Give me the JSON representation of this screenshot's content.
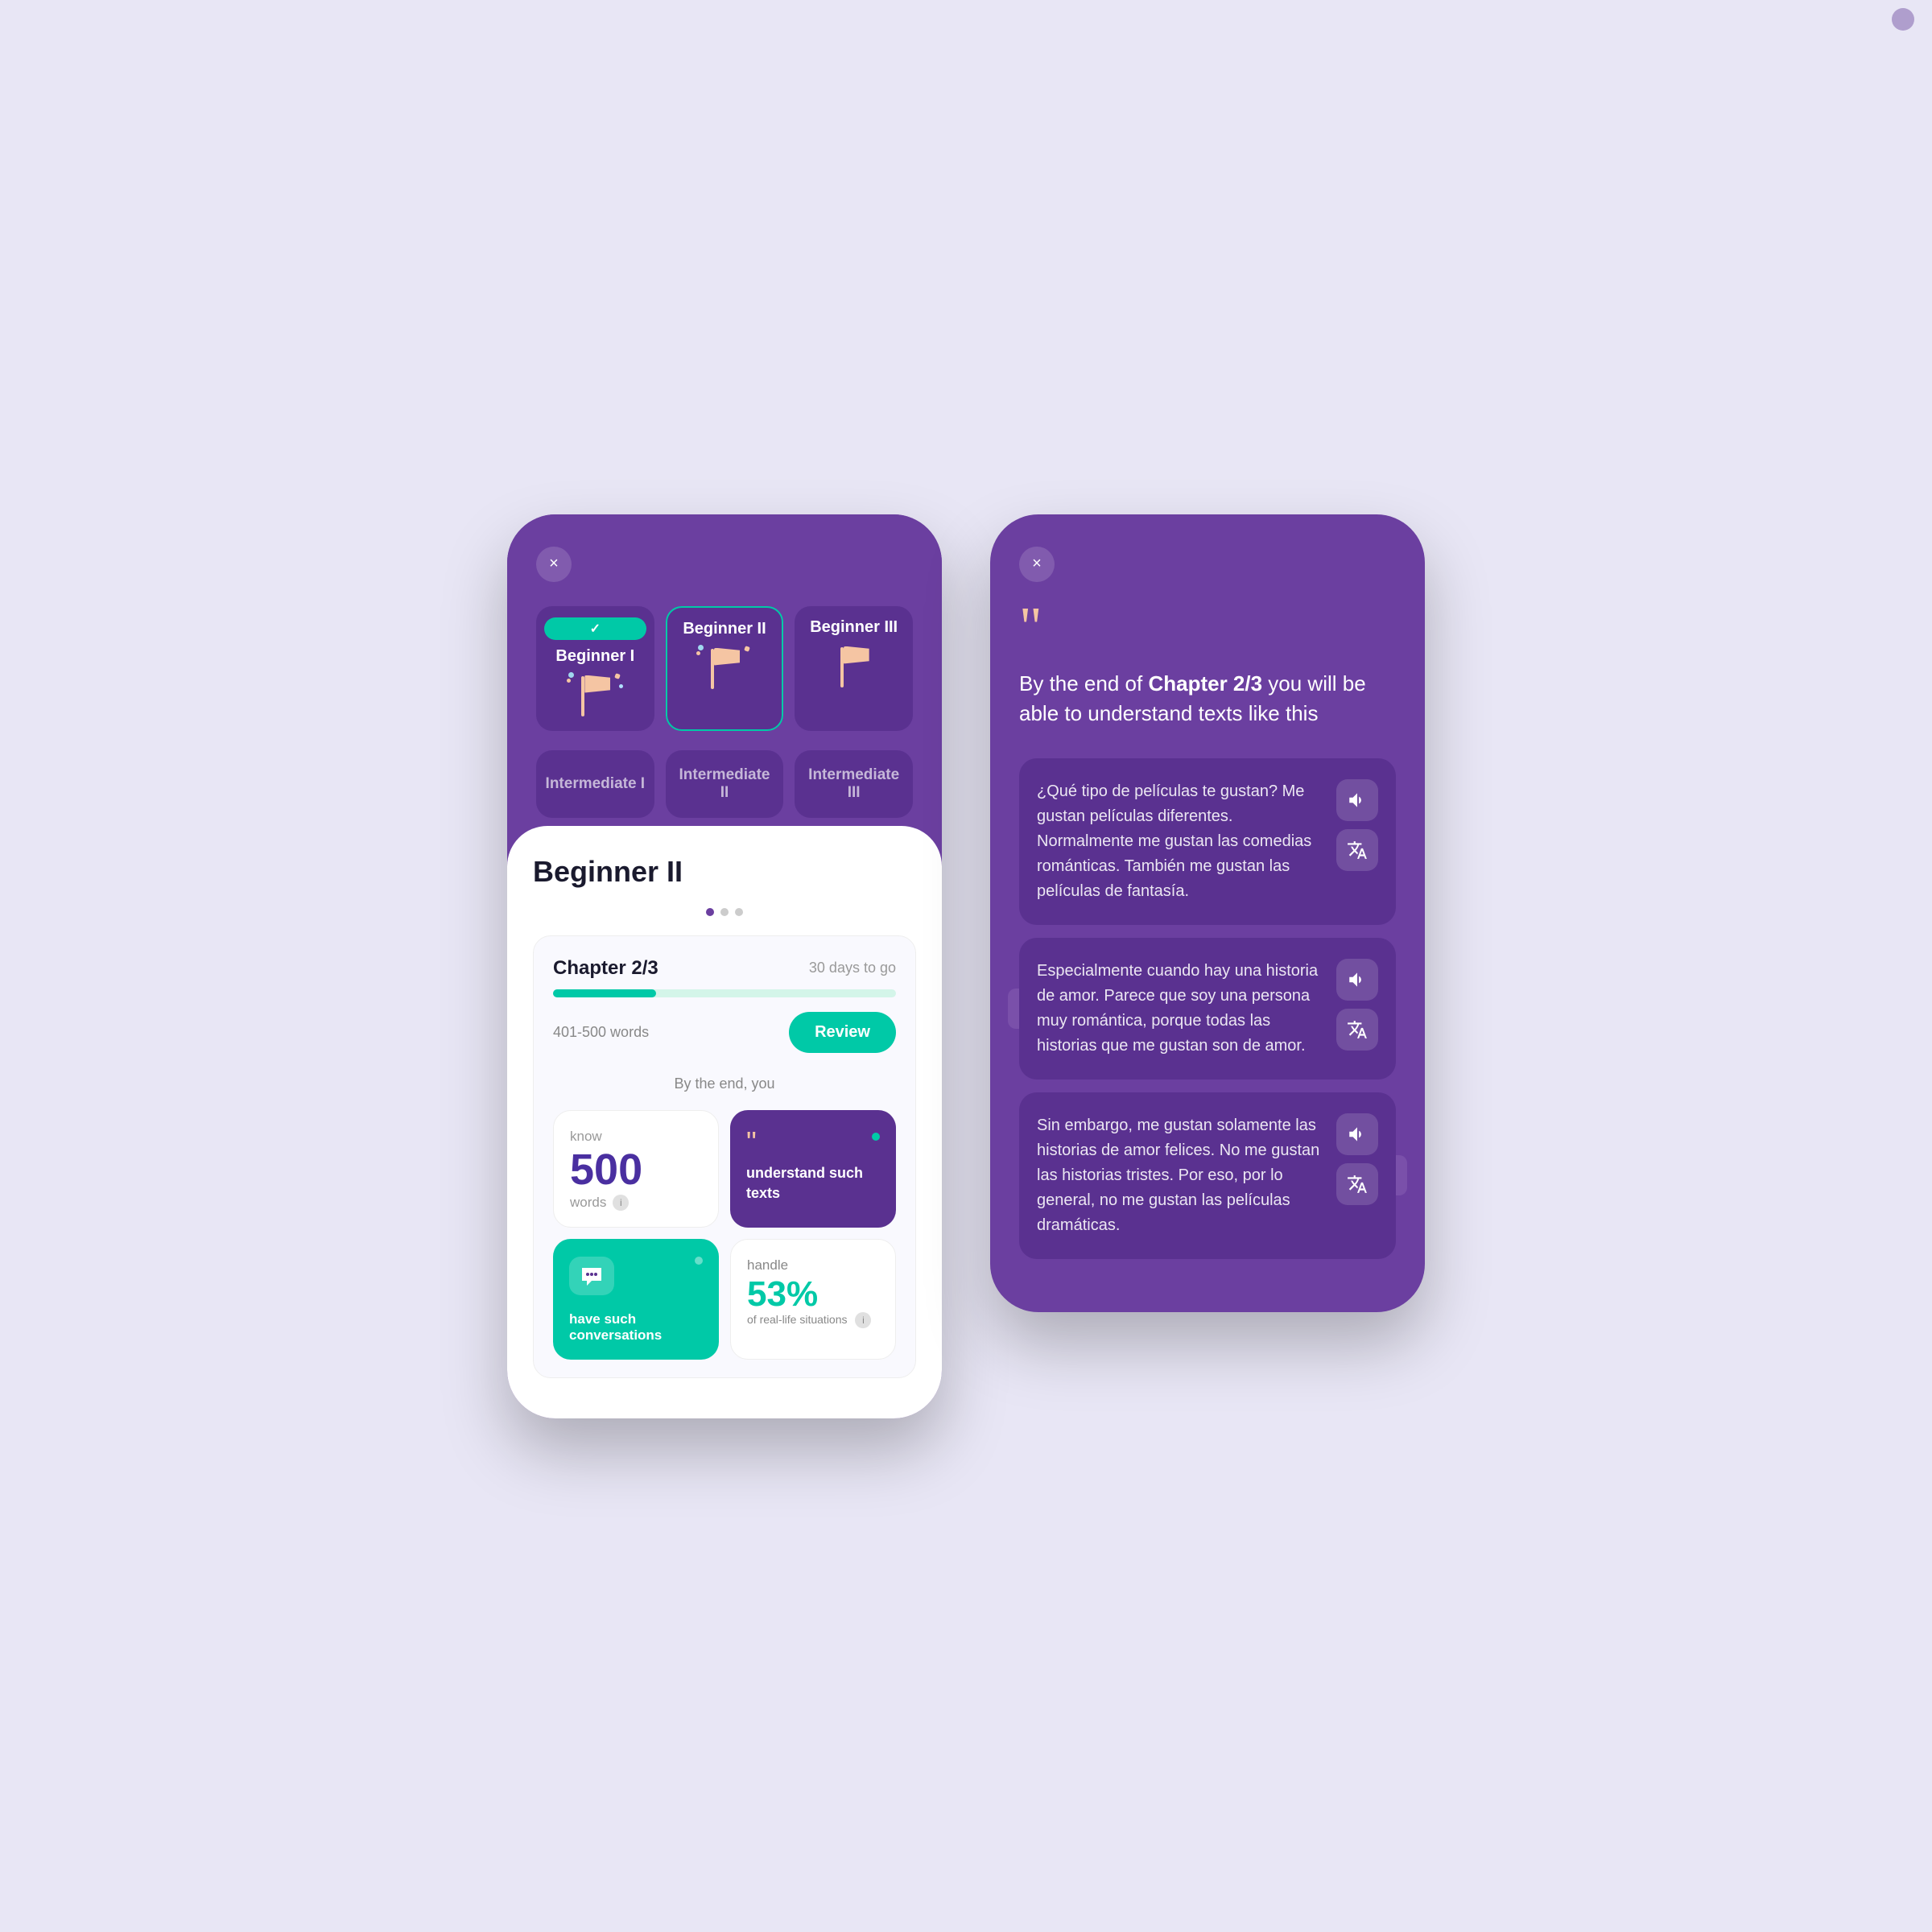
{
  "app": {
    "background": "#e8e6f5"
  },
  "left_phone": {
    "close_label": "×",
    "levels": [
      {
        "id": "beginner-1",
        "label": "Beginner I",
        "state": "completed"
      },
      {
        "id": "beginner-2",
        "label": "Beginner II",
        "state": "active"
      },
      {
        "id": "beginner-3",
        "label": "Beginner III",
        "state": "default"
      }
    ],
    "intermediate_levels": [
      {
        "id": "intermediate-1",
        "label": "Intermediate I"
      },
      {
        "id": "intermediate-2",
        "label": "Intermediate II"
      },
      {
        "id": "intermediate-3",
        "label": "Intermediate III"
      }
    ],
    "sheet": {
      "title": "Beginner II",
      "pagination": {
        "current": 1,
        "total": 3
      },
      "chapter": {
        "title": "Chapter 2/3",
        "days_label": "30 days to go",
        "progress_percent": 30,
        "words_range": "401-500 words",
        "review_button": "Review"
      },
      "by_end_label": "By the end, you",
      "outcomes": {
        "words": {
          "label": "know",
          "number": "500",
          "unit": "words"
        },
        "texts": {
          "quote": "““",
          "label": "understand such texts"
        },
        "conversations": {
          "label": "have such conversations"
        },
        "percent": {
          "label": "handle",
          "number": "53%",
          "description": "of real-life situations"
        }
      }
    }
  },
  "right_phone": {
    "close_label": "×",
    "quote_char": "““",
    "description": "By the end of Chapter 2/3 you will be able to understand texts like this",
    "description_bold": "Chapter 2/3",
    "texts": [
      {
        "id": "text-1",
        "content": "¿Qué tipo de películas te gustan? Me gustan películas diferentes. Normalmente me gustan las comedias románticas. También me gustan las películas de fantasía."
      },
      {
        "id": "text-2",
        "content": "Especialmente cuando hay una historia de amor. Parece que soy una persona muy romántica, porque todas las historias que me gustan son de amor."
      },
      {
        "id": "text-3",
        "content": "Sin embargo, me gustan solamente las historias de amor felices. No me gustan las historias tristes. Por eso, por lo general, no me gustan las películas dramáticas."
      }
    ],
    "button_labels": {
      "audio": "audio",
      "translate": "translate"
    }
  }
}
